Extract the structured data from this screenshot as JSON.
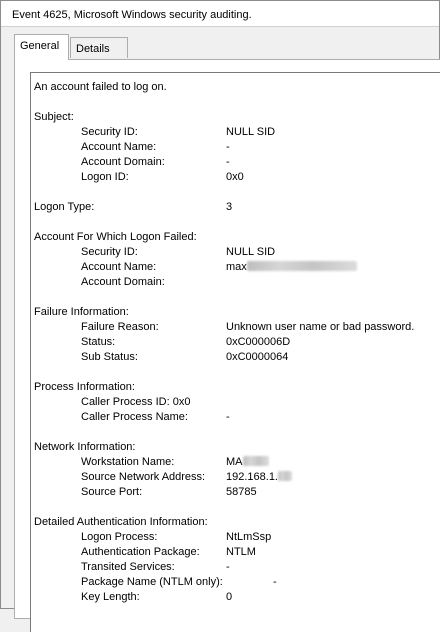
{
  "window": {
    "title": "Event 4625, Microsoft Windows security auditing."
  },
  "tabs": [
    {
      "label": "General",
      "active": true
    },
    {
      "label": "Details",
      "active": false
    }
  ],
  "event": {
    "summary": "An account failed to log on.",
    "subject": {
      "heading": "Subject:",
      "security_id_label": "Security ID:",
      "security_id": "NULL SID",
      "account_name_label": "Account Name:",
      "account_name": "-",
      "account_domain_label": "Account Domain:",
      "account_domain": "-",
      "logon_id_label": "Logon ID:",
      "logon_id": "0x0"
    },
    "logon_type_label": "Logon Type:",
    "logon_type": "3",
    "failed_account": {
      "heading": "Account For Which Logon Failed:",
      "security_id_label": "Security ID:",
      "security_id": "NULL SID",
      "account_name_label": "Account Name:",
      "account_name": "max",
      "account_domain_label": "Account Domain:"
    },
    "failure": {
      "heading": "Failure Information:",
      "reason_label": "Failure Reason:",
      "reason": "Unknown user name or bad password.",
      "status_label": "Status:",
      "status": "0xC000006D",
      "sub_status_label": "Sub Status:",
      "sub_status": "0xC0000064"
    },
    "process": {
      "heading": "Process Information:",
      "caller_pid_label": "Caller Process ID:",
      "caller_pid": "0x0",
      "caller_name_label": "Caller Process Name:",
      "caller_name": "-"
    },
    "network": {
      "heading": "Network Information:",
      "workstation_label": "Workstation Name:",
      "workstation": "MA",
      "source_address_label": "Source Network Address:",
      "source_address": "192.168.1.",
      "source_port_label": "Source Port:",
      "source_port": "58785"
    },
    "auth": {
      "heading": "Detailed Authentication Information:",
      "logon_process_label": "Logon Process:",
      "logon_process": "NtLmSsp",
      "auth_package_label": "Authentication Package:",
      "auth_package": "NTLM",
      "transited_label": "Transited Services:",
      "transited": "-",
      "package_name_label": "Package Name (NTLM only):",
      "package_name": "-",
      "key_length_label": "Key Length:",
      "key_length": "0"
    }
  }
}
